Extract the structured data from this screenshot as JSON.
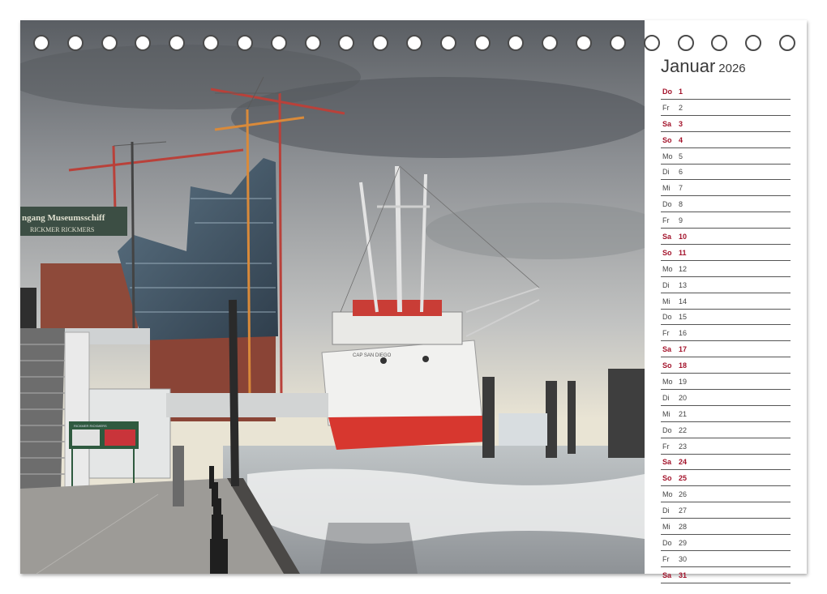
{
  "calendar": {
    "month": "Januar",
    "year": "2026",
    "days": [
      {
        "weekday": "Do",
        "day": "1",
        "highlight": true
      },
      {
        "weekday": "Fr",
        "day": "2",
        "highlight": false
      },
      {
        "weekday": "Sa",
        "day": "3",
        "highlight": true
      },
      {
        "weekday": "So",
        "day": "4",
        "highlight": true
      },
      {
        "weekday": "Mo",
        "day": "5",
        "highlight": false
      },
      {
        "weekday": "Di",
        "day": "6",
        "highlight": false
      },
      {
        "weekday": "Mi",
        "day": "7",
        "highlight": false
      },
      {
        "weekday": "Do",
        "day": "8",
        "highlight": false
      },
      {
        "weekday": "Fr",
        "day": "9",
        "highlight": false
      },
      {
        "weekday": "Sa",
        "day": "10",
        "highlight": true
      },
      {
        "weekday": "So",
        "day": "11",
        "highlight": true
      },
      {
        "weekday": "Mo",
        "day": "12",
        "highlight": false
      },
      {
        "weekday": "Di",
        "day": "13",
        "highlight": false
      },
      {
        "weekday": "Mi",
        "day": "14",
        "highlight": false
      },
      {
        "weekday": "Do",
        "day": "15",
        "highlight": false
      },
      {
        "weekday": "Fr",
        "day": "16",
        "highlight": false
      },
      {
        "weekday": "Sa",
        "day": "17",
        "highlight": true
      },
      {
        "weekday": "So",
        "day": "18",
        "highlight": true
      },
      {
        "weekday": "Mo",
        "day": "19",
        "highlight": false
      },
      {
        "weekday": "Di",
        "day": "20",
        "highlight": false
      },
      {
        "weekday": "Mi",
        "day": "21",
        "highlight": false
      },
      {
        "weekday": "Do",
        "day": "22",
        "highlight": false
      },
      {
        "weekday": "Fr",
        "day": "23",
        "highlight": false
      },
      {
        "weekday": "Sa",
        "day": "24",
        "highlight": true
      },
      {
        "weekday": "So",
        "day": "25",
        "highlight": true
      },
      {
        "weekday": "Mo",
        "day": "26",
        "highlight": false
      },
      {
        "weekday": "Di",
        "day": "27",
        "highlight": false
      },
      {
        "weekday": "Mi",
        "day": "28",
        "highlight": false
      },
      {
        "weekday": "Do",
        "day": "29",
        "highlight": false
      },
      {
        "weekday": "Fr",
        "day": "30",
        "highlight": false
      },
      {
        "weekday": "Sa",
        "day": "31",
        "highlight": true
      }
    ]
  },
  "photo": {
    "sign_text": "ngang Museumsschiff",
    "sign_subtext": "RICKMER RICKMERS",
    "board_text": "RICKMER RICKMERS",
    "ship_bow_text": "CAP SAN DIEGO"
  },
  "colors": {
    "weekend": "#a3132b",
    "weekday": "#444444",
    "ship_hull": "#d7372f",
    "sky_light": "#e9e4d4",
    "sky_dark": "#5a5e63"
  },
  "binding": {
    "ring_count": 23
  }
}
